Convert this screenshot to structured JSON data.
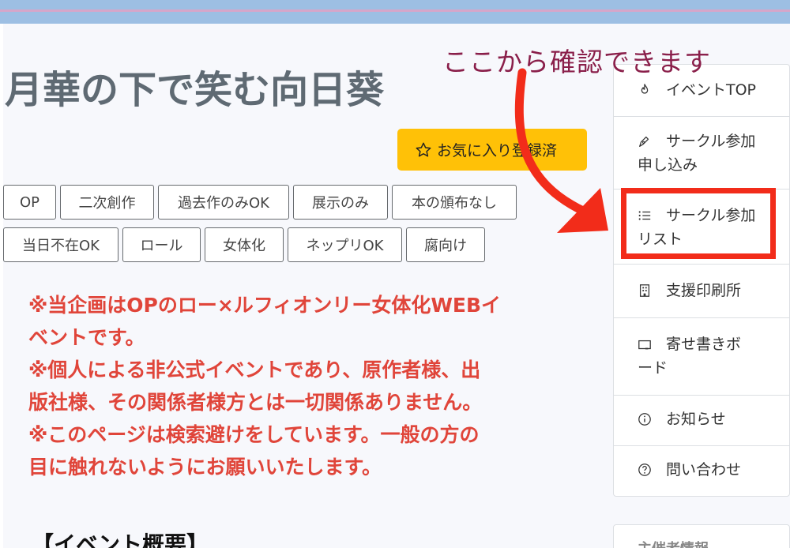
{
  "page": {
    "title": "月華の下で笑む向日葵"
  },
  "favorite": {
    "label": "お気に入り登録済",
    "icon": "star-outline-icon"
  },
  "tags": [
    "OP",
    "二次創作",
    "過去作のみOK",
    "展示のみ",
    "本の頒布なし",
    "当日不在OK",
    "ロール",
    "女体化",
    "ネップリOK",
    "腐向け"
  ],
  "notice": {
    "lines": [
      "※当企画はOPのロー×ルフィオンリー女体化WEBイ",
      "ベントです。",
      "※個人による非公式イベントであり、原作者様、出",
      "版社様、その関係者様方とは一切関係ありません。",
      "※このページは検索避けをしています。一般の方の",
      "目に触れないようにお願いいたします。"
    ]
  },
  "section": {
    "heading": "【イベント概要】"
  },
  "annotation": {
    "text": "ここから確認できます",
    "color": "#8a1f4a",
    "arrow_color": "#f22c1a"
  },
  "sidebar": {
    "items": [
      {
        "name": "nav-event-top",
        "icon": "flame-icon",
        "line1": "イベントTOP",
        "line2": ""
      },
      {
        "name": "nav-circle-apply",
        "icon": "pen-icon",
        "line1": "サークル参加",
        "line2": "申し込み"
      },
      {
        "name": "nav-circle-list",
        "icon": "list-icon",
        "line1": "サークル参加",
        "line2": "リスト"
      },
      {
        "name": "nav-print-shop",
        "icon": "building-icon",
        "line1": "支援印刷所",
        "line2": ""
      },
      {
        "name": "nav-message-board",
        "icon": "board-icon",
        "line1": "寄せ書きボ",
        "line2": "ード"
      },
      {
        "name": "nav-news",
        "icon": "info-icon",
        "line1": "お知らせ",
        "line2": ""
      },
      {
        "name": "nav-contact",
        "icon": "question-icon",
        "line1": "問い合わせ",
        "line2": ""
      }
    ]
  },
  "organizer": {
    "label": "主催者情報"
  },
  "colors": {
    "topbar": "#9dbfe3",
    "accent_yellow": "#ffc107",
    "notice_red": "#e0453a",
    "highlight_red": "#f22c1a"
  }
}
